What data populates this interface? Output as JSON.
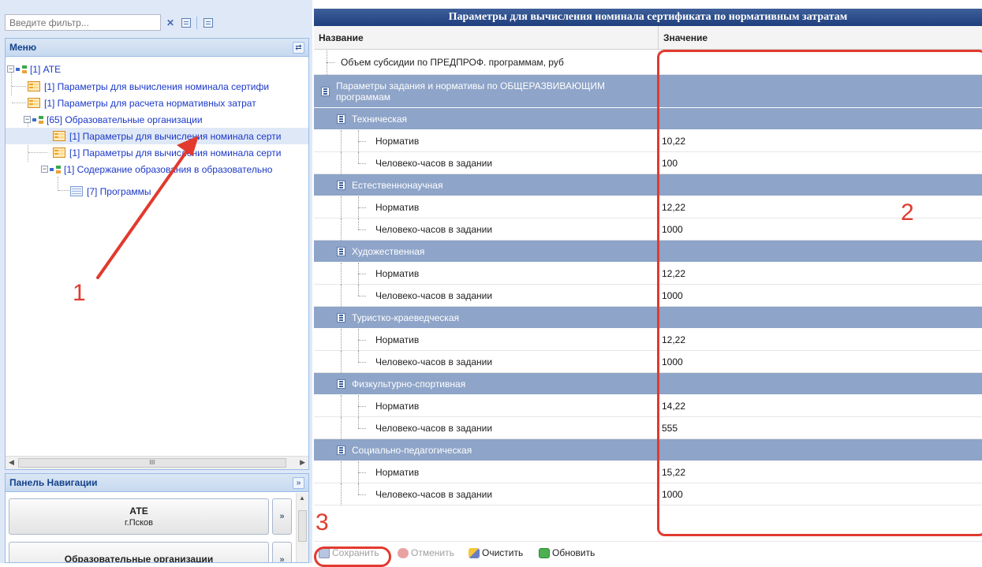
{
  "filter": {
    "placeholder": "Введите фильтр..."
  },
  "menu": {
    "title": "Меню",
    "tree": [
      "[1] АТЕ",
      "[1] Параметры для вычисления номинала сертифи",
      "[1] Параметры для расчета нормативных затрат",
      "[65] Образовательные организации",
      "[1] Параметры для вычисления номинала серти",
      "[1] Параметры для вычисления номинала серти",
      "[1] Содержание образования в образовательно",
      "[7] Программы"
    ],
    "scroll_mark": "III"
  },
  "nav_panel": {
    "title": "Панель Навигации",
    "items": [
      {
        "title": "АТЕ",
        "subtitle": "г.Псков"
      },
      {
        "title": "Образовательные организации",
        "subtitle": ""
      }
    ],
    "go_label": "»"
  },
  "grid": {
    "title": "Параметры для вычисления номинала сертификата по нормативным затратам",
    "col_name": "Название",
    "col_value": "Значение",
    "top_row": {
      "label": "Объем субсидии по ПРЕДПРОФ. программам, руб",
      "value": ""
    },
    "group_title": "Параметры задания и нормативы по ОБЩЕРАЗВИВАЮЩИМ программам",
    "norm_label": "Норматив",
    "hours_label": "Человеко-часов в задании",
    "subgroups": [
      {
        "name": "Техническая",
        "norm": "10,22",
        "hours": "100"
      },
      {
        "name": "Естественнонаучная",
        "norm": "12,22",
        "hours": "1000"
      },
      {
        "name": "Художественная",
        "norm": "12,22",
        "hours": "1000"
      },
      {
        "name": "Туристко-краеведческая",
        "norm": "12,22",
        "hours": "1000"
      },
      {
        "name": "Физкультурно-спортивная",
        "norm": "14,22",
        "hours": "555"
      },
      {
        "name": "Социально-педагогическая",
        "norm": "15,22",
        "hours": "1000"
      }
    ]
  },
  "toolbar": {
    "save": "Сохранить",
    "cancel": "Отменить",
    "clear": "Очистить",
    "refresh": "Обновить"
  },
  "annotations": {
    "one": "1",
    "two": "2",
    "three": "3"
  },
  "colors": {
    "annotation": "#e23a2e",
    "title_bar": "#1f3f7d",
    "group_row": "#8ea4c8",
    "tree_link": "#1b38c8"
  }
}
